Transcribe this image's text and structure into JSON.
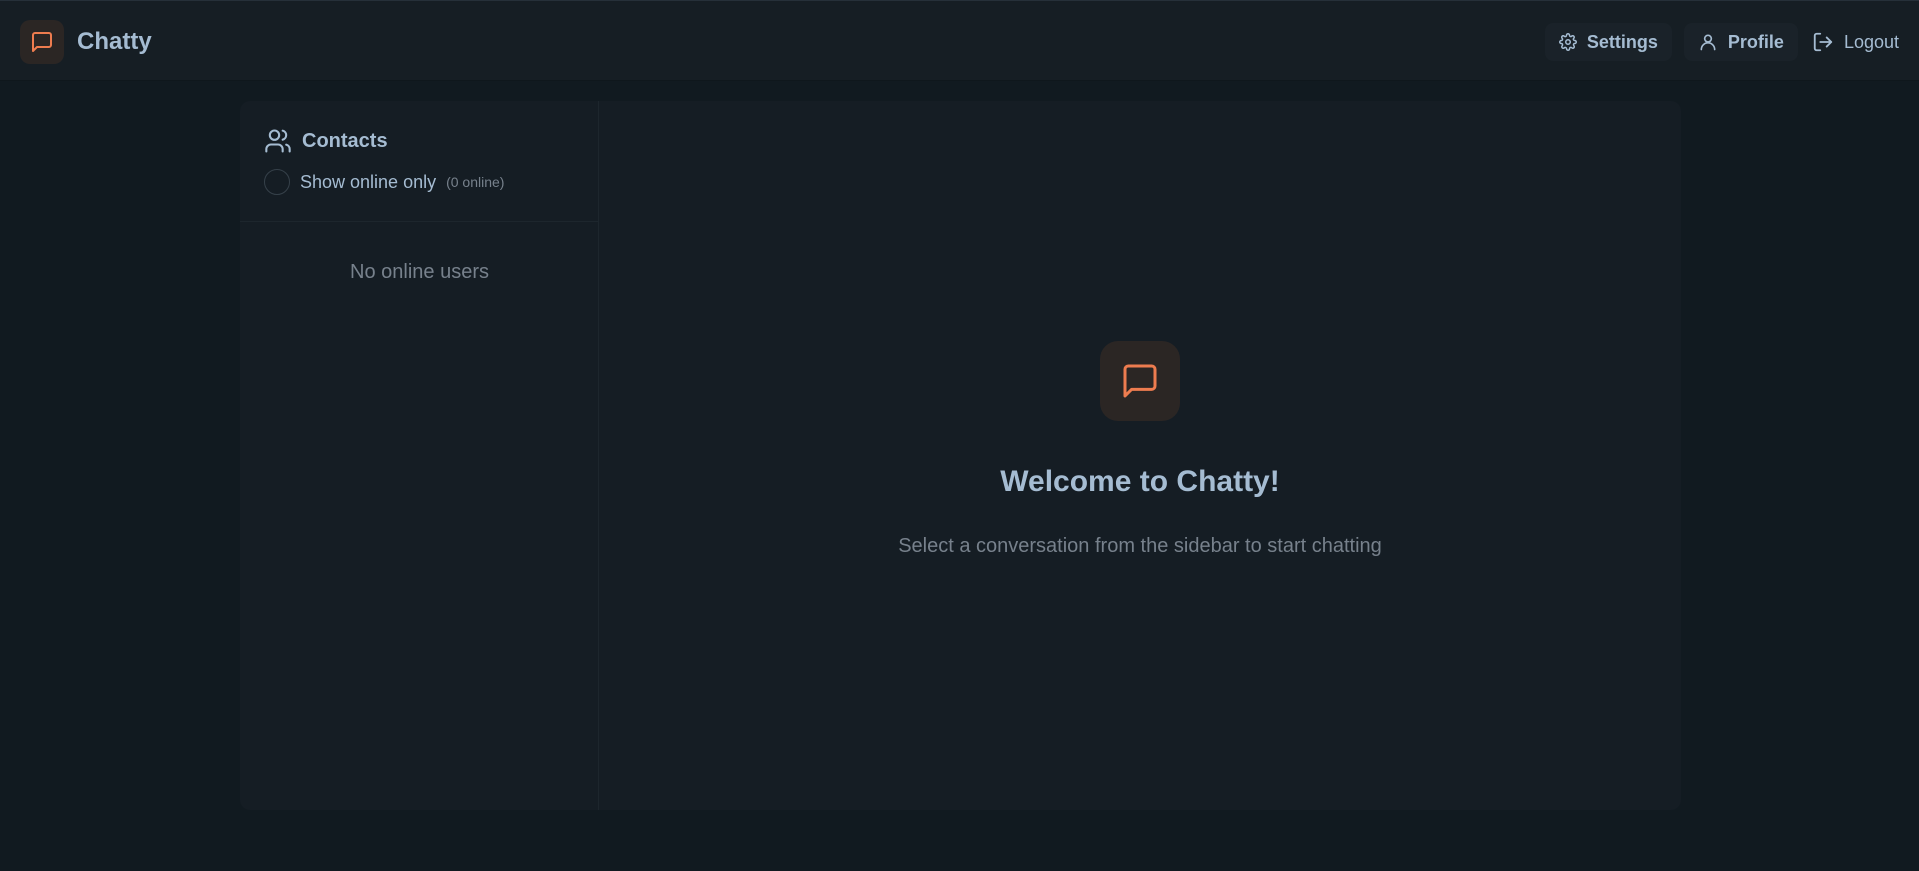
{
  "app": {
    "title": "Chatty",
    "accent_color": "#ee7c4f",
    "text_color": "#a5bcd2",
    "muted_color": "#77818c"
  },
  "navbar": {
    "brand_icon": "message-square-icon",
    "actions": [
      {
        "label": "Settings",
        "icon": "gear-icon"
      },
      {
        "label": "Profile",
        "icon": "user-icon"
      },
      {
        "label": "Logout",
        "icon": "logout-icon"
      }
    ]
  },
  "sidebar": {
    "title": "Contacts",
    "title_icon": "users-icon",
    "filter_label": "Show online only",
    "online_count": "(0 online)",
    "empty_message": "No online users"
  },
  "main": {
    "icon": "message-square-icon",
    "welcome_title": "Welcome to Chatty!",
    "welcome_subtitle": "Select a conversation from the sidebar to start chatting"
  }
}
